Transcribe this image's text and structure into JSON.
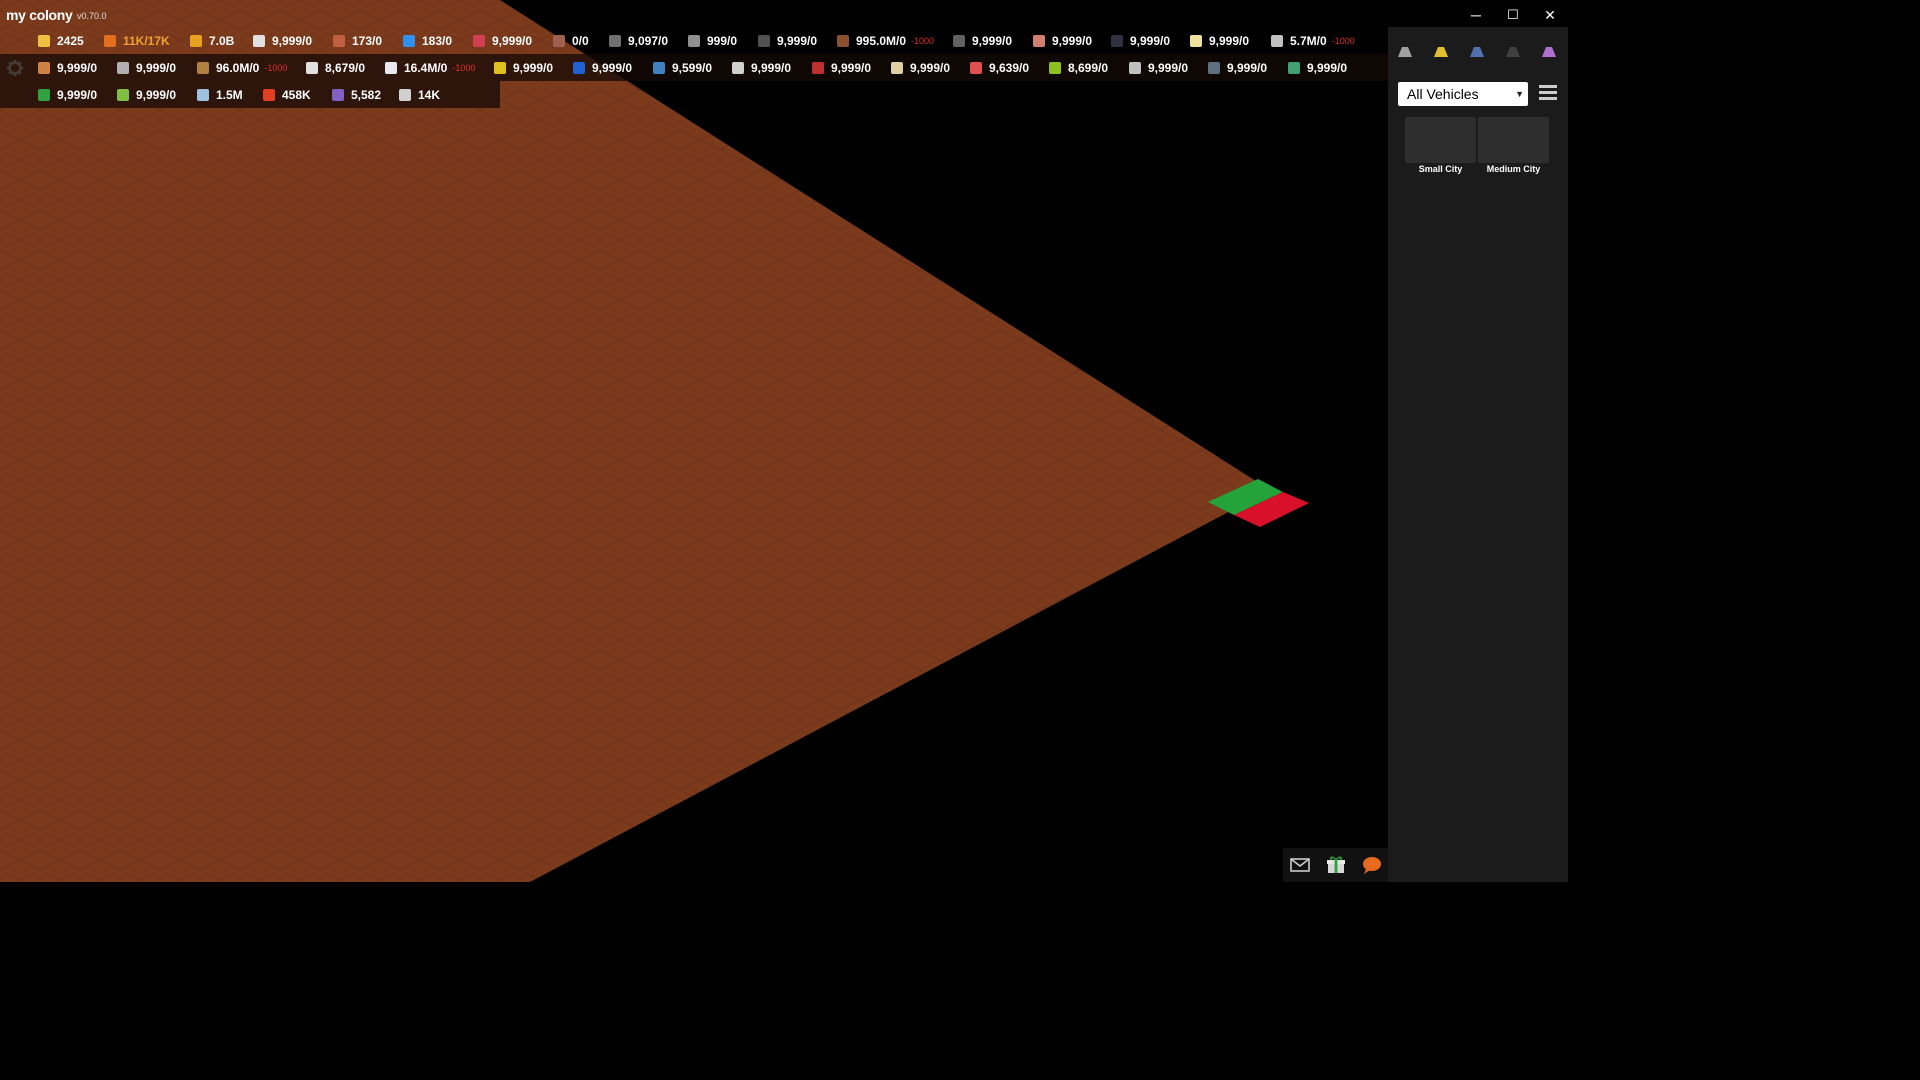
{
  "app": {
    "name": "my colony",
    "version": "v0.70.0"
  },
  "window_controls": {
    "minimize": "─",
    "maximize": "☐",
    "close": "✕"
  },
  "resources": {
    "row1": [
      {
        "icon": "lightbulb-icon",
        "value": "2425",
        "color": "#f0c040",
        "value_color": "#ffffff"
      },
      {
        "icon": "power-bolt-icon",
        "value": "11K/17K",
        "color": "#e07020",
        "value_color": "#f0a030"
      },
      {
        "icon": "coin-icon",
        "value": "7.0B",
        "color": "#e8a020",
        "value_color": "#ffffff"
      },
      {
        "icon": "tent-icon",
        "value": "9,999/0",
        "color": "#e0e0e0",
        "value_color": "#ffffff"
      },
      {
        "icon": "drumstick-icon",
        "value": "173/0",
        "color": "#c06040",
        "value_color": "#ffffff"
      },
      {
        "icon": "water-drop-icon",
        "value": "183/0",
        "color": "#3090f0",
        "value_color": "#ffffff"
      },
      {
        "icon": "science-icon",
        "value": "9,999/0",
        "color": "#d04050",
        "value_color": "#ffffff"
      },
      {
        "icon": "oil-flask-icon",
        "value": "0/0",
        "color": "#a06050",
        "value_color": "#ffffff"
      },
      {
        "icon": "gear-ore-icon",
        "value": "9,097/0",
        "color": "#707070",
        "value_color": "#ffffff"
      },
      {
        "icon": "chisel-icon",
        "value": "999/0",
        "color": "#909090",
        "value_color": "#ffffff"
      },
      {
        "icon": "rock-icon",
        "value": "9,999/0",
        "color": "#505050",
        "value_color": "#ffffff"
      },
      {
        "icon": "ore-icon",
        "value": "995.0M/0",
        "delta": "-1000",
        "color": "#8a5030",
        "value_color": "#ffffff"
      },
      {
        "icon": "stone-icon",
        "value": "9,999/0",
        "color": "#606060",
        "value_color": "#ffffff"
      },
      {
        "icon": "copper-icon",
        "value": "9,999/0",
        "color": "#d08070",
        "value_color": "#ffffff"
      },
      {
        "icon": "coal-icon",
        "value": "9,999/0",
        "color": "#303040",
        "value_color": "#ffffff"
      },
      {
        "icon": "popcorn-icon",
        "value": "9,999/0",
        "color": "#f0e0a0",
        "value_color": "#ffffff"
      },
      {
        "icon": "pipe-icon",
        "value": "5.7M/0",
        "delta": "-1000",
        "color": "#c0c0c0",
        "value_color": "#ffffff"
      }
    ],
    "row2": [
      {
        "icon": "wood-icon",
        "value": "9,999/0",
        "color": "#d08040",
        "value_color": "#ffffff"
      },
      {
        "icon": "microchip-icon",
        "value": "9,999/0",
        "color": "#b0b0b0",
        "value_color": "#ffffff"
      },
      {
        "icon": "sponge-icon",
        "value": "96.0M/0",
        "delta": "-1000",
        "color": "#b08040",
        "value_color": "#ffffff"
      },
      {
        "icon": "steel-icon",
        "value": "8,679/0",
        "color": "#e0e0e0",
        "value_color": "#ffffff"
      },
      {
        "icon": "diamond-icon",
        "value": "16.4M/0",
        "delta": "-1000",
        "color": "#e8e8f0",
        "value_color": "#ffffff"
      },
      {
        "icon": "radiation-icon",
        "value": "9,999/0",
        "color": "#e0c020",
        "value_color": "#ffffff"
      },
      {
        "icon": "feather-icon",
        "value": "9,999/0",
        "color": "#2060d0",
        "value_color": "#ffffff"
      },
      {
        "icon": "boot-icon",
        "value": "9,599/0",
        "color": "#4080c0",
        "value_color": "#ffffff"
      },
      {
        "icon": "cloth-icon",
        "value": "9,999/0",
        "color": "#d0d0d0",
        "value_color": "#ffffff"
      },
      {
        "icon": "brick-icon",
        "value": "9,999/0",
        "color": "#c03030",
        "value_color": "#ffffff"
      },
      {
        "icon": "paper-icon",
        "value": "9,999/0",
        "color": "#e0d0a0",
        "value_color": "#ffffff"
      },
      {
        "icon": "rainbow-icon",
        "value": "9,639/0",
        "color": "#e05050",
        "value_color": "#ffffff"
      },
      {
        "icon": "bacteria-icon",
        "value": "8,699/0",
        "color": "#90c020",
        "value_color": "#ffffff"
      },
      {
        "icon": "bus-icon",
        "value": "9,999/0",
        "color": "#c0c0c0",
        "value_color": "#ffffff"
      },
      {
        "icon": "egg-icon",
        "value": "9,999/0",
        "color": "#607080",
        "value_color": "#ffffff"
      },
      {
        "icon": "painting-icon",
        "value": "9,999/0",
        "color": "#40a070",
        "value_color": "#ffffff"
      }
    ],
    "row3": [
      {
        "icon": "money-icon",
        "value": "9,999/0",
        "color": "#30a040",
        "value_color": "#ffffff"
      },
      {
        "icon": "leaf-icon",
        "value": "9,999/0",
        "color": "#80c040",
        "value_color": "#ffffff"
      },
      {
        "icon": "cloud-icon",
        "value": "1.5M",
        "color": "#a0c0e0",
        "value_color": "#ffffff"
      },
      {
        "icon": "fire-icon",
        "value": "458K",
        "color": "#e04020",
        "value_color": "#ffffff"
      },
      {
        "icon": "potion-icon",
        "value": "5,582",
        "color": "#8060c0",
        "value_color": "#ffffff"
      },
      {
        "icon": "bank-icon",
        "value": "14K",
        "color": "#d0d0d0",
        "value_color": "#ffffff"
      }
    ]
  },
  "sidebar": {
    "tools": [
      {
        "icon": "astronaut-icon",
        "color": "#a0a0a0"
      },
      {
        "icon": "bulldozer-icon",
        "color": "#e0c030"
      },
      {
        "icon": "vehicle-icon",
        "color": "#5070b0"
      },
      {
        "icon": "hovercraft-icon",
        "color": "#404040"
      },
      {
        "icon": "potion-icon",
        "color": "#b070d0"
      }
    ],
    "filter": {
      "selected": "All Vehicles"
    },
    "vehicles": [
      {
        "label": "Small City"
      },
      {
        "label": "Medium City"
      }
    ]
  },
  "map": {
    "ground_color": "#7a3a1c",
    "select_green": "#24a33a",
    "select_red": "#d8102a"
  }
}
